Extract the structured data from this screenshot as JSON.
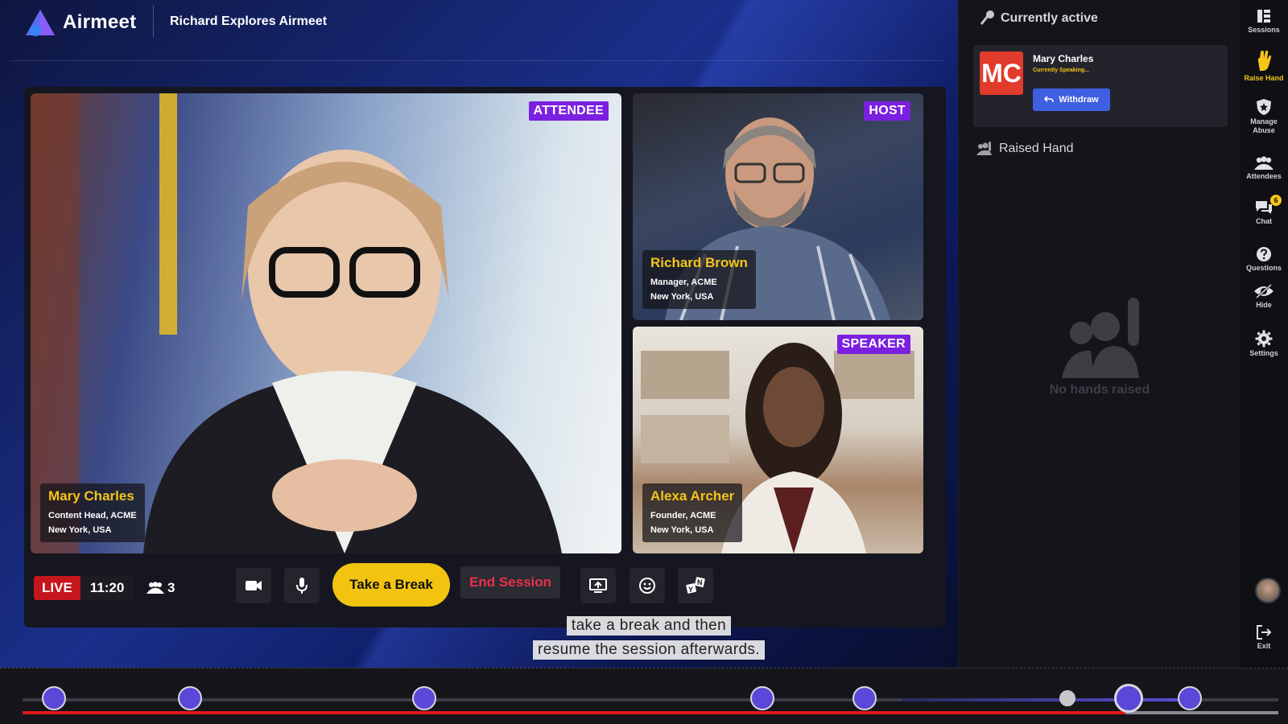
{
  "app": {
    "brand": "Airmeet",
    "event_title": "Richard Explores Airmeet"
  },
  "tiles": [
    {
      "role": "ATTENDEE",
      "name": "Mary Charles",
      "title": "Content Head, ACME",
      "location": "New York, USA"
    },
    {
      "role": "HOST",
      "name": "Richard Brown",
      "title": "Manager, ACME",
      "location": "New York, USA"
    },
    {
      "role": "SPEAKER",
      "name": "Alexa Archer",
      "title": "Founder, ACME",
      "location": "New York, USA"
    }
  ],
  "controls": {
    "live_label": "LIVE",
    "elapsed": "11:20",
    "attendee_count": "3",
    "take_break_label": "Take a Break",
    "end_session_label": "End Session"
  },
  "caption": {
    "line1": "take a break and then",
    "line2": "resume the session afterwards."
  },
  "side_panel": {
    "currently_active_title": "Currently active",
    "active_speaker": {
      "initials": "MC",
      "name": "Mary Charles",
      "status": "Currently Speaking...",
      "withdraw_label": "Withdraw"
    },
    "raised_hand_title": "Raised Hand",
    "empty_message": "No hands raised"
  },
  "rail": {
    "items": [
      {
        "label": "Sessions",
        "icon": "sessions-icon"
      },
      {
        "label": "Raise Hand",
        "icon": "raise-hand-icon",
        "active": true
      },
      {
        "label": "Manage Abuse",
        "icon": "shield-icon"
      },
      {
        "label": "Attendees",
        "icon": "attendees-icon"
      },
      {
        "label": "Chat",
        "icon": "chat-icon",
        "badge": "6"
      },
      {
        "label": "Questions",
        "icon": "question-icon"
      },
      {
        "label": "Hide",
        "icon": "hide-icon"
      },
      {
        "label": "Settings",
        "icon": "gear-icon"
      },
      {
        "label": "Exit",
        "icon": "exit-icon"
      }
    ]
  },
  "colors": {
    "accent_yellow": "#f5c518",
    "role_purple": "#7b1fe0",
    "live_red": "#c4161c",
    "withdraw_blue": "#3d5fe0",
    "avatar_red": "#e13b2b"
  }
}
